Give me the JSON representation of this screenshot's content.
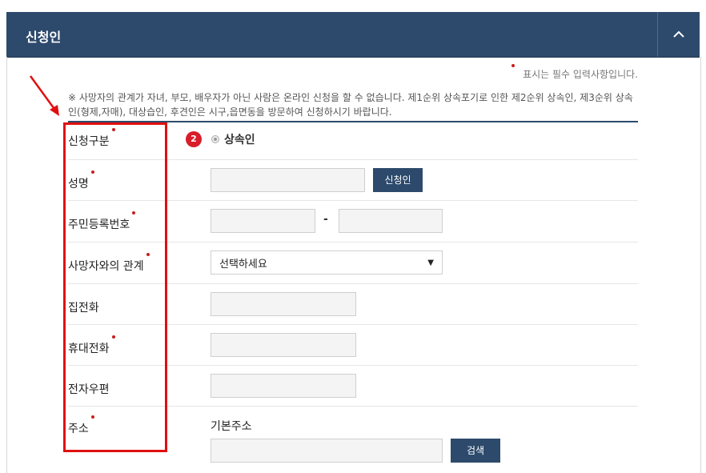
{
  "header": {
    "title": "신청인"
  },
  "required_legend": "표시는 필수 입력사항입니다.",
  "notice": "※ 사망자의 관계가 자녀, 부모, 배우자가 아닌 사람은 온라인 신청을 할 수 없습니다. 제1순위 상속포기로 인한 제2순위 상속인, 제3순위 상속인(형제,자매), 대상습인, 후견인은 시구,읍면동을 방문하여 신청하시기 바랍니다.",
  "badge": "2",
  "fields": {
    "type_label": "신청구분",
    "type_option": "상속인",
    "name_label": "성명",
    "name_button": "신청인",
    "rrn_label": "주민등록번호",
    "rrn_dash": "-",
    "relation_label": "사망자와의 관계",
    "relation_selected": "선택하세요",
    "home_phone_label": "집전화",
    "mobile_label": "휴대전화",
    "email_label": "전자우편",
    "address_label": "주소",
    "address_basic_label": "기본주소",
    "address_search_button": "검색"
  },
  "colors": {
    "header_bg": "#2d4a6c",
    "required": "#c81e1e",
    "highlight": "#e01010"
  }
}
